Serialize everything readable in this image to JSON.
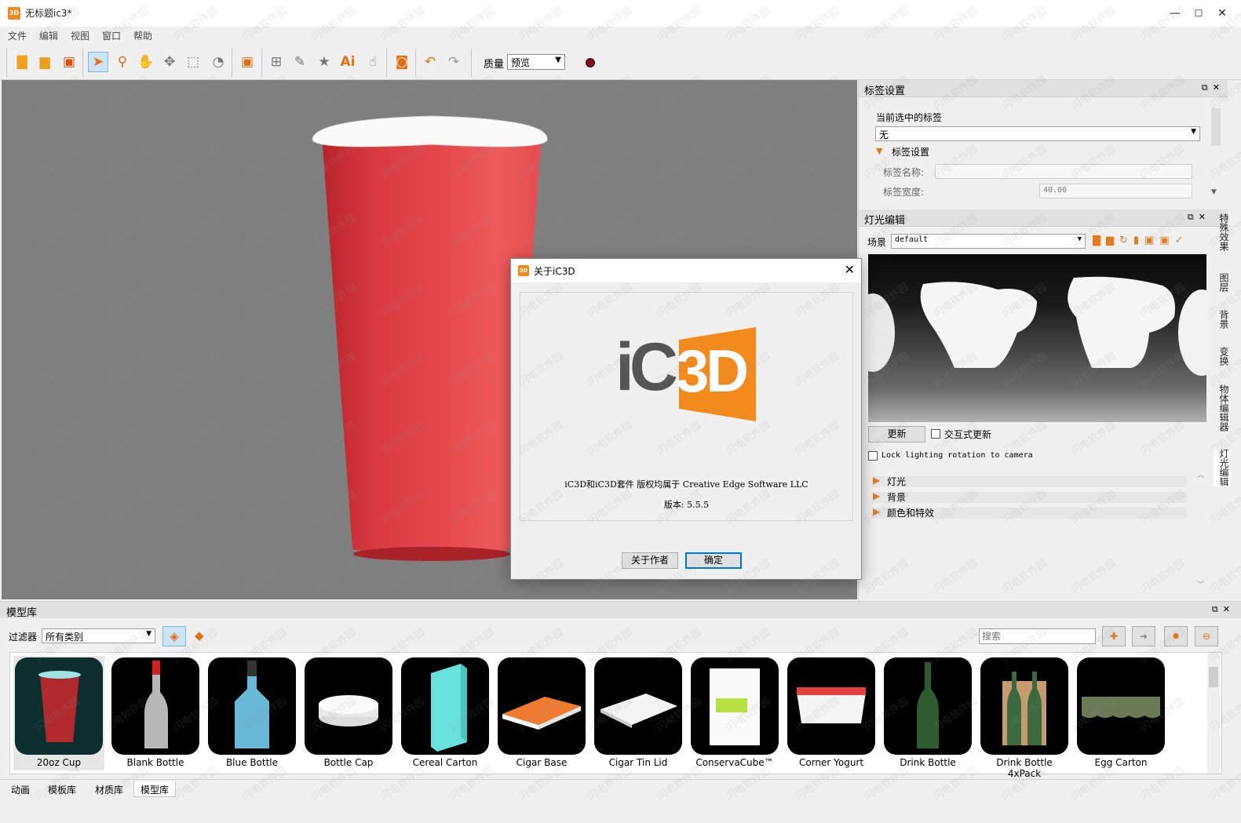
{
  "window": {
    "title": "无标题ic3*",
    "logo_text": "3D",
    "minimize": "—",
    "maximize": "☐",
    "close": "✕"
  },
  "menu": [
    "文件",
    "编辑",
    "视图",
    "窗口",
    "帮助"
  ],
  "toolbar": {
    "quality_label": "质量",
    "quality_value": "预览",
    "record_color": "#7b0f0f"
  },
  "label_panel": {
    "title": "标签设置",
    "current_label_caption": "当前选中的标签",
    "current_label_value": "无",
    "section_title": "标签设置",
    "name_label": "标签名称:",
    "name_value": "",
    "width_label": "标签宽度:",
    "width_value": "40.00"
  },
  "light_panel": {
    "title": "灯光编辑",
    "scene_label": "场景",
    "scene_value": "default",
    "update_button": "更新",
    "interactive_label": "交互式更新",
    "lock_label": "Lock lighting rotation to camera",
    "sections": [
      "灯光",
      "背景",
      "颜色和特效"
    ]
  },
  "side_tabs": [
    "特殊效果",
    "图层",
    "背景",
    "变换",
    "物体编辑器",
    "灯光编辑"
  ],
  "dialog": {
    "title": "关于iC3D",
    "logo_ic": "iC",
    "logo_3d": "3D",
    "copyright": "iC3D和iC3D套件 版权均属于 Creative Edge Software LLC",
    "version": "版本: 5.5.5",
    "about_button": "关于作者",
    "ok_button": "确定",
    "brand_color": "#f28a1e"
  },
  "library": {
    "title": "模型库",
    "filter_label": "过滤器",
    "filter_value": "所有类别",
    "search_placeholder": "搜索",
    "items": [
      "20oz Cup",
      "Blank Bottle",
      "Blue Bottle",
      "Bottle Cap",
      "Cereal Carton",
      "Cigar Base",
      "Cigar Tin Lid",
      "ConservaCube™",
      "Corner Yogurt",
      "Drink Bottle",
      "Drink Bottle 4xPack",
      "Egg Carton"
    ]
  },
  "bottom_tabs": [
    "动画",
    "模板库",
    "材质库",
    "模型库"
  ],
  "watermark": "闪电软件园"
}
